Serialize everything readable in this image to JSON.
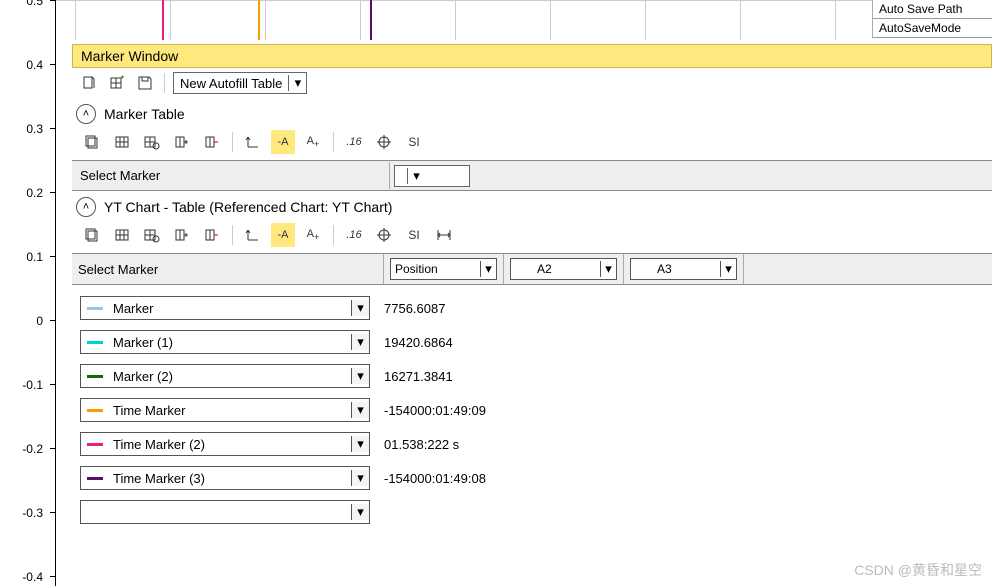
{
  "chart": {
    "yticks": [
      "0.5",
      "0.4",
      "0.3",
      "0.2",
      "0.1",
      "0",
      "-0.1",
      "-0.2",
      "-0.3",
      "-0.4"
    ]
  },
  "props": {
    "row1": "Auto Save Path",
    "row2": "AutoSaveMode"
  },
  "marker_window": {
    "title": "Marker Window",
    "autofill_label": "New Autofill Table",
    "section_marker_table": "Marker Table",
    "select_marker_label": "Select Marker",
    "yt_section": "YT Chart - Table  (Referenced Chart: YT Chart)",
    "columns": {
      "select": "Select Marker",
      "c1": "Position",
      "c2": "A2",
      "c3": "A3"
    },
    "rows": [
      {
        "name": "Marker",
        "color": "#9cc4e4",
        "value": "7756.6087"
      },
      {
        "name": "Marker (1)",
        "color": "#00d0d6",
        "value": "19420.6864"
      },
      {
        "name": "Marker (2)",
        "color": "#0a6d00",
        "value": "16271.3841"
      },
      {
        "name": "Time Marker",
        "color": "#f59f00",
        "value": "-154000:01:49:09"
      },
      {
        "name": "Time Marker (2)",
        "color": "#e61f7b",
        "value": "01.538:222 s"
      },
      {
        "name": "Time Marker (3)",
        "color": "#5a0c70",
        "value": "-154000:01:49:08"
      }
    ],
    "swatch_colors": {
      "c2": "#0033cc",
      "c3": "#0a6d00"
    }
  },
  "watermark": "CSDN @黄昏和星空"
}
